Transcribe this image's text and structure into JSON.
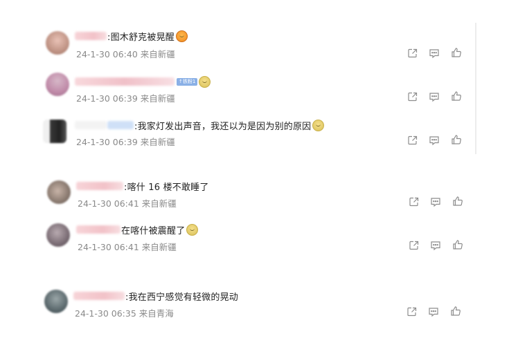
{
  "comments": [
    {
      "text": ":图木舒克被晃醒",
      "emoji": "orange",
      "time": "24-1-30 06:40",
      "source": "来自新疆",
      "badge": ""
    },
    {
      "text": "",
      "emoji": "yellow",
      "time": "24-1-30 06:39",
      "source": "来自新疆",
      "badge": "铁粉1"
    },
    {
      "text": ":我家灯发出声音，我还以为是因为别的原因",
      "emoji": "yellow",
      "time": "24-1-30 06:39",
      "source": "来自新疆",
      "badge": ""
    },
    {
      "text": ":喀什 16 楼不敢睡了",
      "emoji": "",
      "time": "24-1-30 06:41",
      "source": "来自新疆",
      "badge": ""
    },
    {
      "text": "在喀什被震醒了",
      "emoji": "yellow",
      "time": "24-1-30 06:41",
      "source": "来自新疆",
      "badge": ""
    },
    {
      "text": ":我在西宁感觉有轻微的晃动",
      "emoji": "",
      "time": "24-1-30 06:35",
      "source": "来自青海",
      "badge": ""
    }
  ],
  "icons": {
    "share": "share-icon",
    "comment": "comment-icon",
    "like": "like-icon"
  }
}
